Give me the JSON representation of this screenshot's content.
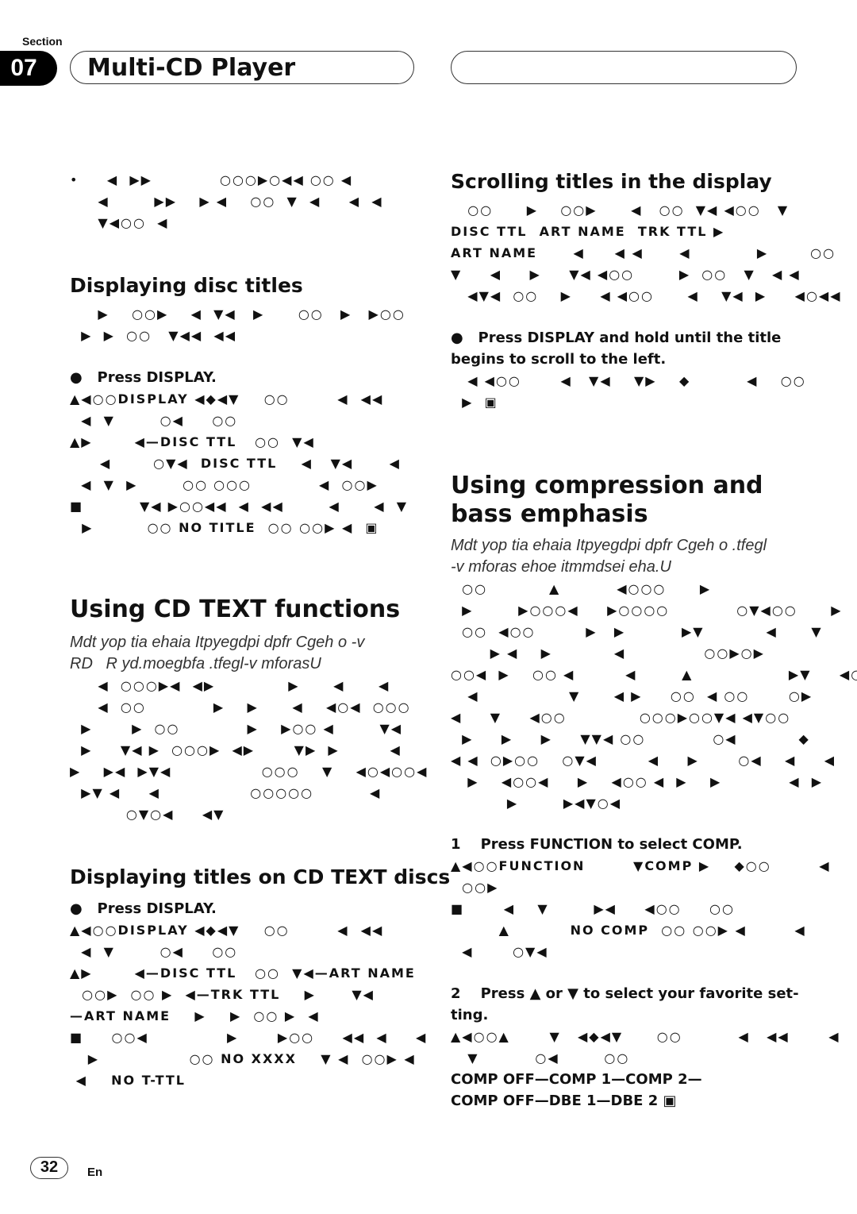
{
  "header": {
    "section_label": "Section",
    "section_number": "07",
    "chapter_title": "Multi-CD Player"
  },
  "left": {
    "intro_lines": [
      "•     ◀  ▶▶            ○○○▶○◀◀ ○○ ◀",
      "     ◀        ▶▶    ▶ ◀    ○○  ▼  ◀     ◀  ◀",
      "     ▼◀○○  ◀"
    ],
    "disc_titles": {
      "heading": "Displaying disc titles",
      "lines": [
        "     ▶    ○○▶    ◀  ▼◀   ▶      ○○   ▶   ▶○○",
        "  ▶  ▶  ○○   ▼◀◀  ◀◀"
      ],
      "step": "●   Press DISPLAY.",
      "step_lines": [
        "▲◀○○DISPLAY ◀◆◀▼    ○○        ◀  ◀◀",
        "  ◀  ▼        ○◀     ○○",
        "▲▶       ◀—DISC TTL   ○○  ▼◀",
        "     ◀       ○▼◀  DISC TTL    ◀   ▼◀      ◀",
        "  ◀  ▼  ▶        ○○ ○○○            ◀  ○○▶",
        "■          ▼◀ ▶○○◀◀  ◀  ◀◀        ◀      ◀  ▼",
        "  ▶         ○○ NO TITLE  ○○ ○○▶ ◀  ▣"
      ]
    },
    "cd_text": {
      "heading": "Using CD TEXT functions",
      "italic_lines": [
        "Mdt yop tia ehaia Itpyegdpi dpfr Cgeh o -v",
        "RD   R yd.moegbfa .tfegl-v mforasU"
      ],
      "lines": [
        "     ◀  ○○○▶◀  ◀▶             ▶      ◀      ◀",
        "     ◀  ○○            ▶    ▶      ◀    ◀○◀  ○○○",
        "  ▶       ▶  ○○            ▶    ▶○○ ◀        ▼◀",
        "  ▶     ▼◀ ▶  ○○○▶  ◀▶       ▼▶  ▶         ◀",
        "▶    ▶◀  ▶▼◀                ○○○    ▼    ◀○◀○○◀",
        "  ▶▼ ◀     ◀                ○○○○○          ◀",
        "          ○▼○◀     ◀▼"
      ]
    },
    "cd_text_titles": {
      "heading": "Displaying titles on CD TEXT discs",
      "step": "●   Press DISPLAY.",
      "step_lines": [
        "▲◀○○DISPLAY ◀◆◀▼    ○○        ◀  ◀◀",
        "  ◀  ▼        ○◀     ○○",
        "▲▶       ◀—DISC TTL   ○○  ▼◀—ART NAME",
        "  ○○▶  ○○ ▶  ◀—TRK TTL    ▶      ▼◀",
        "—ART NAME    ▶    ▶  ○○ ▶  ◀",
        "■     ○○◀              ▶       ▶○○     ◀◀  ◀     ◀",
        "   ▶               ○○ NO XXXX    ▼ ◀  ○○▶ ◀",
        " ◀    NO T-TTL"
      ]
    }
  },
  "right": {
    "scrolling": {
      "heading": "Scrolling titles in the display",
      "lines": [
        "   ○○      ▶    ○○▶      ◀   ○○  ▼◀ ◀○○   ▼",
        "DISC TTL  ART NAME  TRK TTL ▶",
        "ART NAME      ◀     ◀ ◀      ◀           ▶       ○○",
        "▼     ◀     ▶     ▼◀ ◀○○        ▶  ○○   ▼   ◀ ◀",
        "   ◀▼◀  ○○    ▶     ◀ ◀○○      ◀    ▼◀  ▶     ◀○◀◀"
      ],
      "step": "●   Press DISPLAY and hold until the title",
      "step_cont": "begins to scroll to the left.",
      "step_lines": [
        "   ◀ ◀○○       ◀   ▼◀    ▼▶    ◆          ◀    ○○",
        "  ▶  ▣"
      ]
    },
    "compression": {
      "heading_line1": "Using compression and",
      "heading_line2": "bass emphasis",
      "italic_lines": [
        "Mdt yop tia ehaia Itpyegdpi dpfr Cgeh o .tfegl",
        "-v mforas ehoe itmmdsei eha.U"
      ],
      "lines": [
        "  ○○           ▲          ◀○○○      ▶",
        "  ▶        ▶○○○◀     ▶○○○○            ○▼◀○○      ▶",
        "  ○○  ◀○○         ▶   ▶          ▶▼           ◀      ▼",
        "       ▶ ◀    ▶           ◀              ○○▶○▶",
        "○○◀  ▶    ○○ ◀         ◀        ▲                 ▶▼     ◀○○",
        "   ◀                ▼      ◀ ▶     ○○  ◀ ○○       ○▶",
        "◀     ▼     ◀○○             ○○○▶○○▼◀ ◀▼○○            ◀",
        "  ▶     ▶     ▶     ▼▼◀ ○○            ○◀           ◆          ◀",
        "◀ ◀  ○▶○○    ○▼◀         ◀     ▶       ○◀    ◀     ◀",
        "   ▶    ◀○○◀     ▶    ◀○○ ◀  ▶    ▶            ◀  ▶",
        "          ▶        ▶◀▼○◀"
      ],
      "step1": "1    Press FUNCTION to select COMP.",
      "step1_lines": [
        "▲◀○○FUNCTION        ▼COMP ▶    ◆○○        ◀",
        "  ○○▶",
        "■       ◀    ▼        ▶◀     ◀○○     ○○",
        "        ▲          NO COMP  ○○ ○○▶ ◀        ◀          ▶",
        "  ◀       ○▼◀"
      ],
      "step2": "2    Press ▲ or ▼ to select your favorite set-",
      "step2_cont": "ting.",
      "step2_lines": [
        "▲◀○○▲       ▼   ◀◆◀▼      ○○          ◀   ◀◀       ◀",
        "   ▼          ○◀        ○○"
      ],
      "sequence1": "COMP OFF—COMP 1—COMP 2—",
      "sequence2": "COMP OFF—DBE 1—DBE 2 ▣"
    }
  },
  "footer": {
    "page_number": "32",
    "language": "En"
  }
}
